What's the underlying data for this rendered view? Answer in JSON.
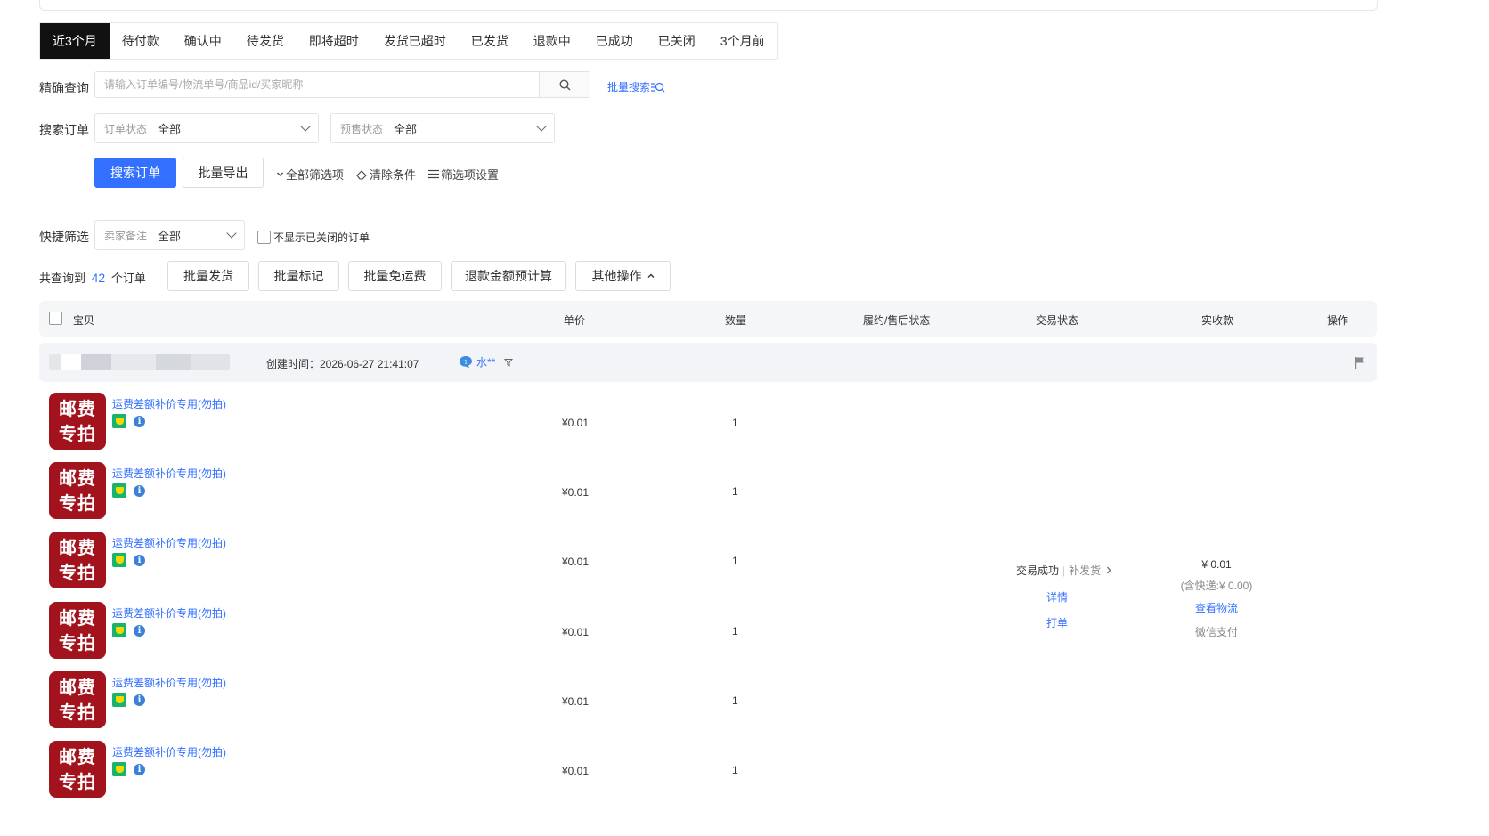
{
  "tabs": [
    "近3个月",
    "待付款",
    "确认中",
    "待发货",
    "即将超时",
    "发货已超时",
    "已发货",
    "退款中",
    "已成功",
    "已关闭",
    "3个月前"
  ],
  "precise_search": {
    "label": "精确查询",
    "placeholder": "请输入订单编号/物流单号/商品id/买家昵称",
    "batch_search": "批量搜索"
  },
  "search_orders": {
    "label": "搜索订单",
    "order_status_label": "订单状态",
    "order_status_value": "全部",
    "presale_status_label": "预售状态",
    "presale_status_value": "全部"
  },
  "actions": {
    "search": "搜索订单",
    "export": "批量导出",
    "all_filters": "全部筛选项",
    "clear": "清除条件",
    "filter_settings": "筛选项设置"
  },
  "quick_filter": {
    "label": "快捷筛选",
    "remark_label": "卖家备注",
    "remark_value": "全部",
    "hide_closed": "不显示已关闭的订单"
  },
  "result": {
    "prefix": "共查询到",
    "count": "42",
    "suffix": "个订单",
    "batch_ship": "批量发货",
    "batch_mark": "批量标记",
    "batch_free_shipping": "批量免运费",
    "refund_estimate": "退款金额预计算",
    "other_ops": "其他操作"
  },
  "table_header": {
    "item": "宝贝",
    "unit_price": "单价",
    "quantity": "数量",
    "fulfillment": "履约/售后状态",
    "trade_status": "交易状态",
    "received": "实收款",
    "operation": "操作"
  },
  "order": {
    "created": "创建时间：2026-06-27 21:41:07",
    "buyer": "水**",
    "items": [
      {
        "thumb_line1": "邮费",
        "thumb_line2": "专拍",
        "title": "运费差额补价专用(勿拍)",
        "price": "¥0.01",
        "qty": "1"
      },
      {
        "thumb_line1": "邮费",
        "thumb_line2": "专拍",
        "title": "运费差额补价专用(勿拍)",
        "price": "¥0.01",
        "qty": "1"
      },
      {
        "thumb_line1": "邮费",
        "thumb_line2": "专拍",
        "title": "运费差额补价专用(勿拍)",
        "price": "¥0.01",
        "qty": "1"
      },
      {
        "thumb_line1": "邮费",
        "thumb_line2": "专拍",
        "title": "运费差额补价专用(勿拍)",
        "price": "¥0.01",
        "qty": "1"
      },
      {
        "thumb_line1": "邮费",
        "thumb_line2": "专拍",
        "title": "运费差额补价专用(勿拍)",
        "price": "¥0.01",
        "qty": "1"
      },
      {
        "thumb_line1": "邮费",
        "thumb_line2": "专拍",
        "title": "运费差额补价专用(勿拍)",
        "price": "¥0.01",
        "qty": "1"
      }
    ],
    "trade_status": "交易成功",
    "reship": "补发货",
    "detail": "详情",
    "print": "打单",
    "amount": "¥ 0.01",
    "shipping_note": "(含快递:¥ 0.00)",
    "view_logistics": "查看物流",
    "payment": "微信支付"
  },
  "colors": {
    "accent": "#3370ff",
    "tab_active_bg": "#111111",
    "thumb_bg": "#a3131d"
  }
}
